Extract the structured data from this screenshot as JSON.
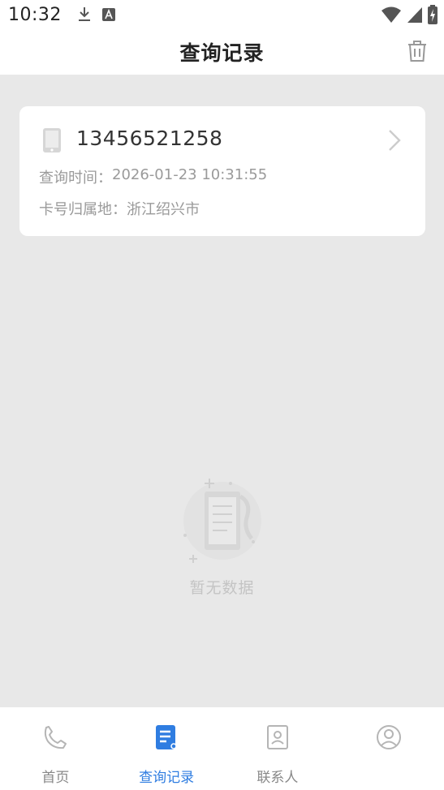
{
  "status_bar": {
    "time": "10:32",
    "left_icons": [
      "download-icon",
      "a-badge-icon"
    ],
    "right_icons": [
      "wifi-icon",
      "signal-icon",
      "battery-icon"
    ]
  },
  "header": {
    "title": "查询记录",
    "action_icon": "trash-icon"
  },
  "records": [
    {
      "phone": "13456521258",
      "time_label": "查询时间：",
      "time_value": "2026-01-23 10:31:55",
      "location_label": "卡号归属地：",
      "location_value": "浙江绍兴市"
    }
  ],
  "empty_state": {
    "text": "暂无数据"
  },
  "tabbar": {
    "tabs": [
      {
        "label": "首页",
        "icon": "phone-icon",
        "active": false
      },
      {
        "label": "查询记录",
        "icon": "document-icon",
        "active": true
      },
      {
        "label": "联系人",
        "icon": "contact-book-icon",
        "active": false
      },
      {
        "label": "",
        "icon": "user-circle-icon",
        "active": false
      }
    ]
  },
  "colors": {
    "accent": "#2f7de1",
    "background": "#e8e8e8",
    "card": "#ffffff",
    "muted_text": "#9a9a9a"
  }
}
